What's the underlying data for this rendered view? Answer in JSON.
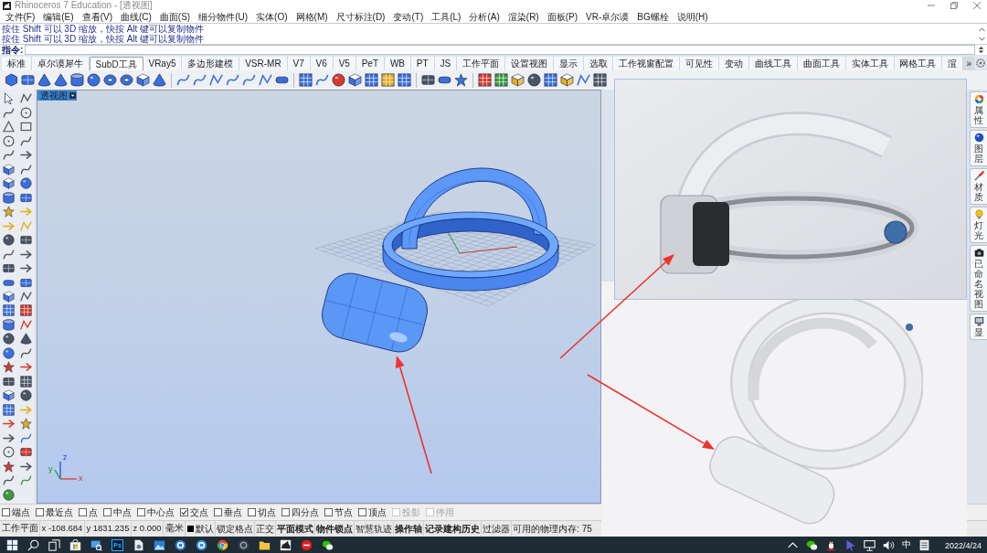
{
  "window": {
    "title": "Rhinoceros 7 Education - [透视图]"
  },
  "menu": [
    "文件(F)",
    "编辑(E)",
    "查看(V)",
    "曲线(C)",
    "曲面(S)",
    "细分物件(U)",
    "实体(O)",
    "网格(M)",
    "尺寸标注(D)",
    "变动(T)",
    "工具(L)",
    "分析(A)",
    "渲染(R)",
    "面板(P)",
    "VR-卓尔谟",
    "BG螺栓",
    "说明(H)"
  ],
  "command_history": [
    "按住 Shift 可以 3D 缩放，快按 Alt 键可以复制物件",
    "按住 Shift 可以 3D 缩放，快按 Alt 键可以复制物件"
  ],
  "command_prompt": "指令:",
  "tabs": [
    {
      "label": "标准",
      "selected": false
    },
    {
      "label": "卓尔谟犀牛",
      "selected": false
    },
    {
      "label": "SubD工具",
      "selected": true
    },
    {
      "label": "VRay5",
      "selected": false
    },
    {
      "label": "多边形建模",
      "selected": false
    },
    {
      "label": "VSR-MR",
      "selected": false
    },
    {
      "label": "V7",
      "selected": false
    },
    {
      "label": "V6",
      "selected": false
    },
    {
      "label": "V5",
      "selected": false
    },
    {
      "label": "PeT",
      "selected": false
    },
    {
      "label": "WB",
      "selected": false
    },
    {
      "label": "PT",
      "selected": false
    },
    {
      "label": "JS",
      "selected": false
    },
    {
      "label": "工作平面",
      "selected": false
    },
    {
      "label": "设置视图",
      "selected": false
    },
    {
      "label": "显示",
      "selected": false
    },
    {
      "label": "选取",
      "selected": false
    },
    {
      "label": "工作视窗配置",
      "selected": false
    },
    {
      "label": "可见性",
      "selected": false
    },
    {
      "label": "变动",
      "selected": false
    },
    {
      "label": "曲线工具",
      "selected": false
    },
    {
      "label": "曲面工具",
      "selected": false
    },
    {
      "label": "实体工具",
      "selected": false
    },
    {
      "label": "网格工具",
      "selected": false
    },
    {
      "label": "渲",
      "selected": false
    }
  ],
  "tabs_overflow": "»",
  "viewport": {
    "label": "透视图",
    "axes": [
      "x",
      "y",
      "z"
    ]
  },
  "side_panels": [
    "属性",
    "图层",
    "材质",
    "灯光",
    "已命名视图",
    "显"
  ],
  "osnaps": [
    {
      "label": "端点",
      "checked": false,
      "disabled": false
    },
    {
      "label": "最近点",
      "checked": false,
      "disabled": false
    },
    {
      "label": "点",
      "checked": false,
      "disabled": false
    },
    {
      "label": "中点",
      "checked": false,
      "disabled": false
    },
    {
      "label": "中心点",
      "checked": false,
      "disabled": false
    },
    {
      "label": "交点",
      "checked": true,
      "disabled": false
    },
    {
      "label": "垂点",
      "checked": false,
      "disabled": false
    },
    {
      "label": "切点",
      "checked": false,
      "disabled": false
    },
    {
      "label": "四分点",
      "checked": false,
      "disabled": false
    },
    {
      "label": "节点",
      "checked": false,
      "disabled": false
    },
    {
      "label": "顶点",
      "checked": false,
      "disabled": false
    },
    {
      "label": "投影",
      "checked": false,
      "disabled": true
    },
    {
      "label": "停用",
      "checked": false,
      "disabled": true
    }
  ],
  "status_bar": {
    "cells": [
      "工作平面",
      "x -108.684",
      "y 1831.235",
      "z 0.000",
      "毫米"
    ],
    "layer": "默认",
    "toggles": [
      {
        "label": "锁定格点",
        "on": false
      },
      {
        "label": "正交",
        "on": false
      },
      {
        "label": "平面模式",
        "on": true
      },
      {
        "label": "物件锁点",
        "on": true
      },
      {
        "label": "智慧轨迹",
        "on": false
      },
      {
        "label": "操作轴",
        "on": true
      },
      {
        "label": "记录建构历史",
        "on": true
      },
      {
        "label": "过滤器",
        "on": false
      }
    ],
    "memory": "可用的物理内存: 75"
  },
  "taskbar": {
    "app_label": "Ps",
    "input_method": "中",
    "date": "2022/4/24"
  }
}
